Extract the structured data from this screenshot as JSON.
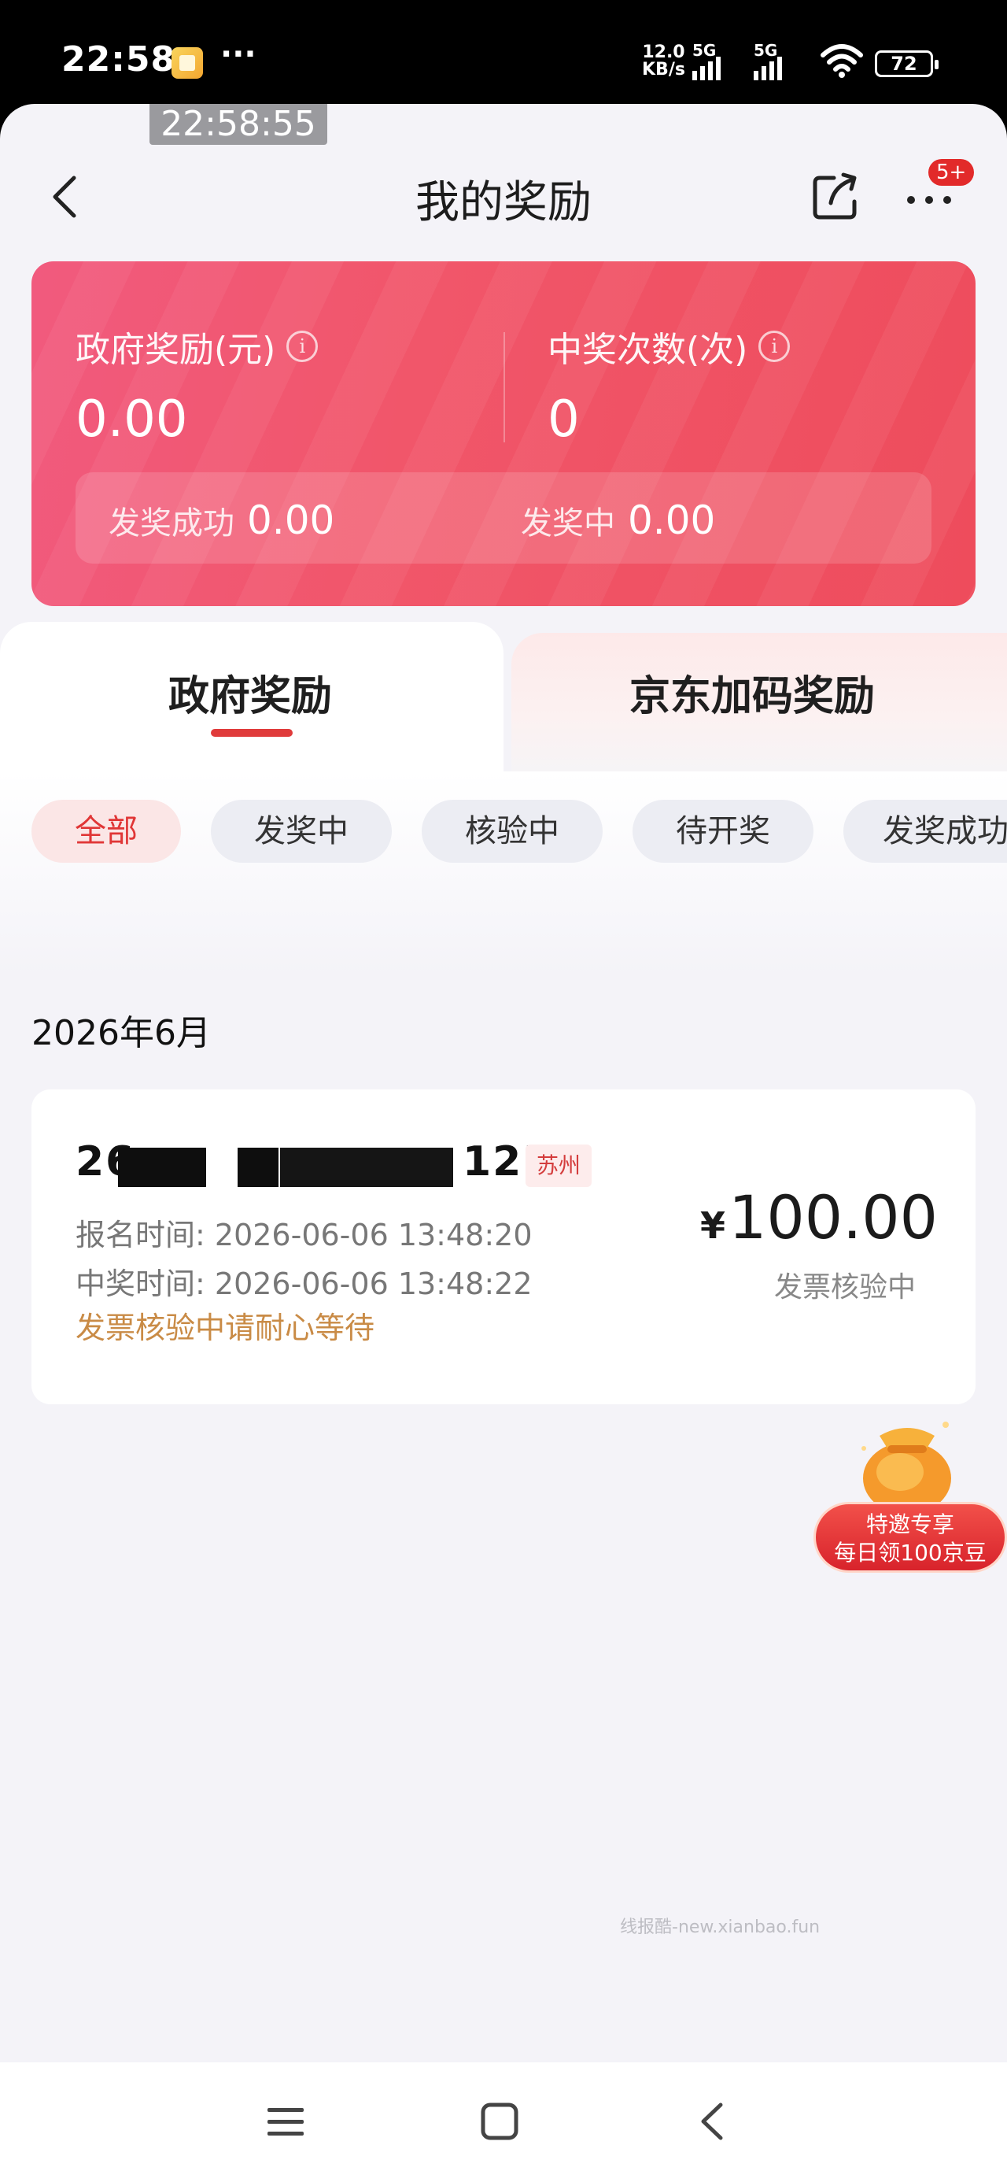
{
  "status_bar": {
    "time": "22:58",
    "more": "···",
    "net_speed_value": "12.0",
    "net_speed_unit": "KB/s",
    "sig1_label": "5G",
    "sig2_label": "5G",
    "battery": "72"
  },
  "overlay_time": "22:58:55",
  "header": {
    "title": "我的奖励",
    "more_badge": "5+"
  },
  "summary": {
    "gov_reward_label": "政府奖励(元)",
    "gov_reward_value": "0.00",
    "win_count_label": "中奖次数(次)",
    "win_count_value": "0",
    "paid_label": "发奖成功",
    "paid_value": "0.00",
    "paying_label": "发奖中",
    "paying_value": "0.00"
  },
  "tabs": [
    {
      "label": "政府奖励",
      "active": true
    },
    {
      "label": "京东加码奖励",
      "active": false
    }
  ],
  "filters": [
    {
      "label": "全部",
      "active": true
    },
    {
      "label": "发奖中",
      "active": false
    },
    {
      "label": "核验中",
      "active": false
    },
    {
      "label": "待开奖",
      "active": false
    },
    {
      "label": "发奖成功",
      "active": false
    }
  ],
  "month_header": "2026年6月",
  "record": {
    "id_prefix": "26",
    "id_suffix": "125",
    "city": "苏州",
    "signup_label": "报名时间:",
    "signup_time": "2026-06-06 13:48:20",
    "win_label": "中奖时间:",
    "win_time": "2026-06-06 13:48:22",
    "note": "发票核验中请耐心等待",
    "currency": "¥",
    "amount": "100.00",
    "status": "发票核验中"
  },
  "promo": {
    "line1": "特邀专享",
    "line2": "每日领100京豆"
  },
  "watermark": "线报酷-new.xianbao.fun",
  "colors": {
    "accent_red": "#e03b3b",
    "card_gradient_start": "#f15a7e",
    "card_gradient_end": "#ee4c5c",
    "note_orange": "#c98b46"
  }
}
